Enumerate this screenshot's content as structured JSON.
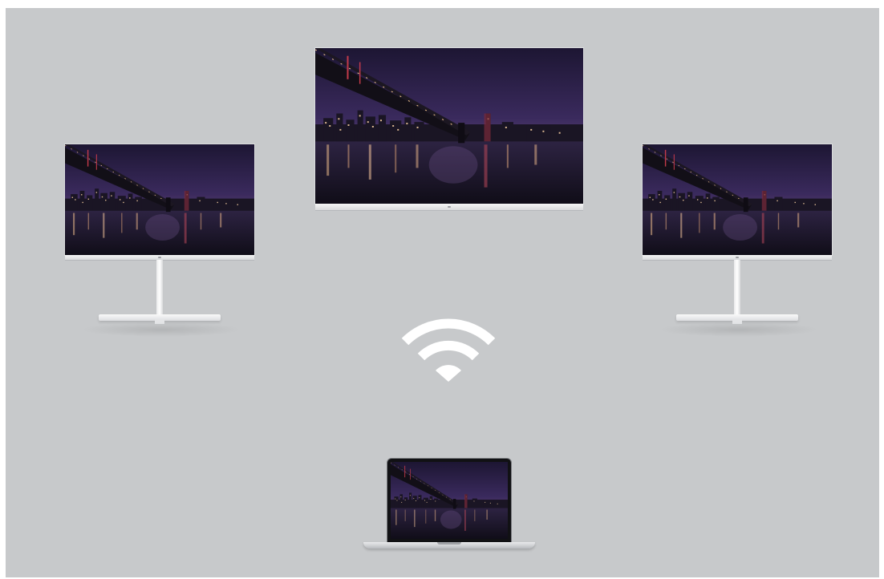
{
  "scene": {
    "background_color": "#c7c9cb",
    "screen_image": "night-city-bridge-skyline",
    "connectivity_icon": "wifi-icon",
    "devices": [
      {
        "id": "center-tv",
        "kind": "wall-monitor"
      },
      {
        "id": "left-monitor",
        "kind": "stand-monitor"
      },
      {
        "id": "right-monitor",
        "kind": "stand-monitor"
      },
      {
        "id": "laptop",
        "kind": "laptop"
      }
    ]
  },
  "colors": {
    "sky_top": "#221a3a",
    "sky_mid": "#3b2a5e",
    "sky_horizon": "#5a3f70",
    "water": "#1e1830",
    "bridge": "#120f16",
    "lights": "#ffd7a8",
    "wifi": "#ffffff"
  }
}
